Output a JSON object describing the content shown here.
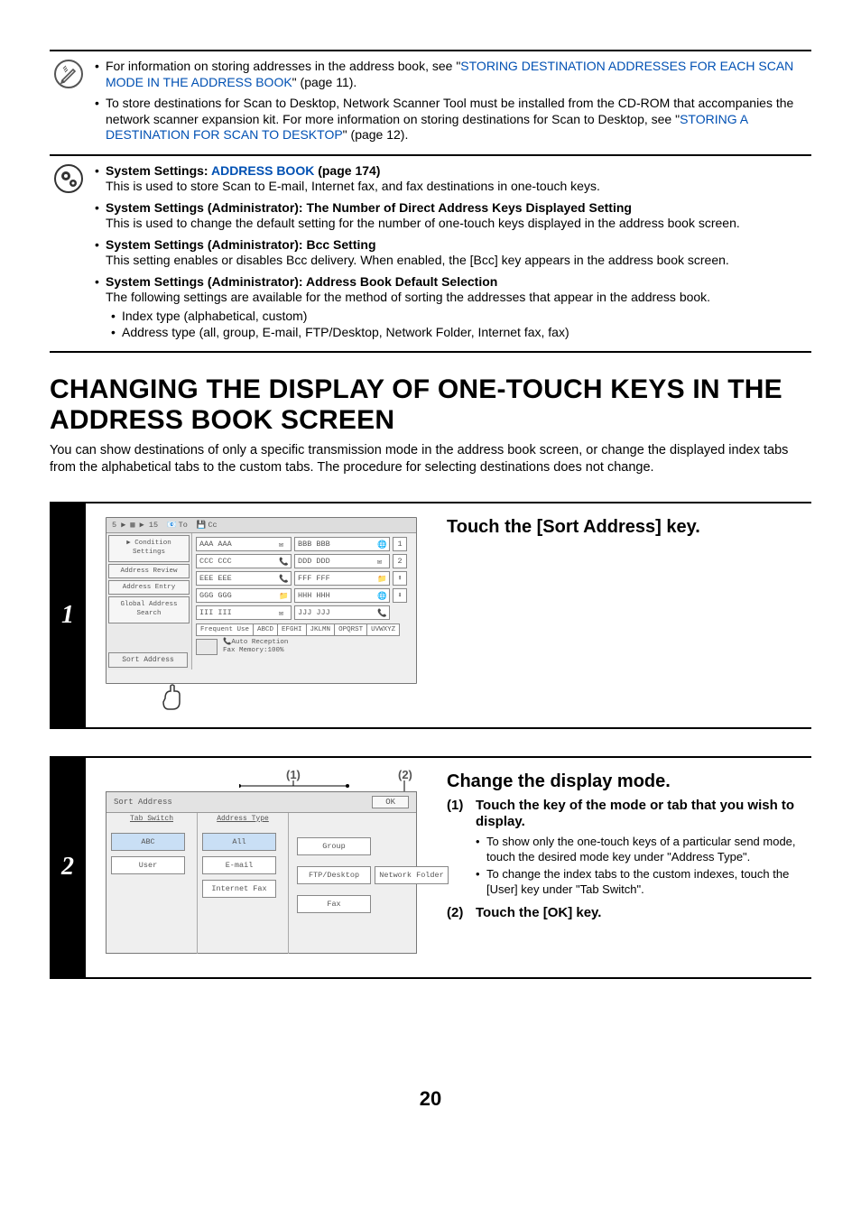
{
  "note1": {
    "items": [
      {
        "prefix": "For information on storing addresses in the address book, see \"",
        "link": "STORING DESTINATION ADDRESSES FOR EACH SCAN MODE IN THE ADDRESS BOOK",
        "suffix": "\" (page 11)."
      },
      {
        "prefix": "To store destinations for Scan to Desktop, Network Scanner Tool must be installed from the CD-ROM that accompanies the network scanner expansion kit. For more information on storing destinations for Scan to Desktop, see \"",
        "link": "STORING A DESTINATION FOR SCAN TO DESKTOP",
        "suffix": "\" (page 12)."
      }
    ]
  },
  "note2": {
    "items": [
      {
        "title_prefix": "System Settings: ",
        "title_link": "ADDRESS BOOK",
        "title_suffix": " (page 174)",
        "desc": "This is used to store Scan to E-mail, Internet fax, and fax destinations in one-touch keys."
      },
      {
        "title": "System Settings (Administrator): The Number of Direct Address Keys Displayed Setting",
        "desc": "This is used to change the default setting for the number of one-touch keys displayed in the address book screen."
      },
      {
        "title": "System Settings (Administrator): Bcc Setting",
        "desc": "This setting enables or disables Bcc delivery. When enabled, the [Bcc] key appears in the address book screen."
      },
      {
        "title": "System Settings (Administrator): Address Book Default Selection",
        "desc": "The following settings are available for the method of sorting the addresses that appear in the address book.",
        "subs": [
          "Index type (alphabetical, custom)",
          "Address type (all, group, E-mail, FTP/Desktop, Network Folder, Internet fax, fax)"
        ]
      }
    ]
  },
  "heading": "CHANGING THE DISPLAY OF ONE-TOUCH KEYS IN THE ADDRESS BOOK SCREEN",
  "lead": "You can show destinations of only a specific transmission mode in the address book screen, or change the displayed index tabs from the alphabetical tabs to the custom tabs. The procedure for selecting destinations does not change.",
  "step1": {
    "num": "1",
    "title": "Touch the [Sort Address] key.",
    "screen": {
      "breadcrumb_count": "5 ▶ ▦ ▶ 15",
      "to_label": "To",
      "cc_label": "Cc",
      "sidebar": [
        "Condition\nSettings",
        "Address Review",
        "Address Entry",
        "Global\nAddress Search"
      ],
      "dests": [
        {
          "name": "AAA AAA",
          "icon": "mail"
        },
        {
          "name": "BBB BBB",
          "icon": "net"
        },
        {
          "name": "CCC CCC",
          "icon": "phone"
        },
        {
          "name": "DDD DDD",
          "icon": "mail"
        },
        {
          "name": "EEE EEE",
          "icon": "phone"
        },
        {
          "name": "FFF FFF",
          "icon": "folder"
        },
        {
          "name": "GGG GGG",
          "icon": "folder"
        },
        {
          "name": "HHH HHH",
          "icon": "net"
        },
        {
          "name": "III III",
          "icon": "mail"
        },
        {
          "name": "JJJ JJJ",
          "icon": "phone"
        }
      ],
      "pager": [
        "1",
        "2",
        "⬆",
        "⬇"
      ],
      "tabs": [
        "Frequent Use",
        "ABCD",
        "EFGHI",
        "JKLMN",
        "OPQRST",
        "UVWXYZ"
      ],
      "sort_label": "Sort Address",
      "foot": "Auto Reception\nFax Memory:100%",
      "preview_icon": "▧"
    }
  },
  "step2": {
    "num": "2",
    "title": "Change the display mode.",
    "callouts": {
      "c1": "(1)",
      "c2": "(2)"
    },
    "screen": {
      "title": "Sort Address",
      "ok": "OK",
      "col1_title": "Tab Switch",
      "col2_title": "Address Type",
      "col1": [
        "ABC",
        "User"
      ],
      "col2": [
        "All",
        "E-mail",
        "Internet Fax"
      ],
      "col3": [
        "Group",
        "FTP/Desktop",
        "Fax"
      ],
      "col4_extra": "Network Folder"
    },
    "subs": [
      {
        "title": "Touch the key of the mode or tab that you wish to display.",
        "bullets": [
          "To show only the one-touch keys of a particular send mode, touch the desired mode key under \"Address Type\".",
          "To change the index tabs to the custom indexes, touch the [User] key under \"Tab Switch\"."
        ]
      },
      {
        "title": "Touch the [OK] key."
      }
    ]
  },
  "page_num": "20"
}
